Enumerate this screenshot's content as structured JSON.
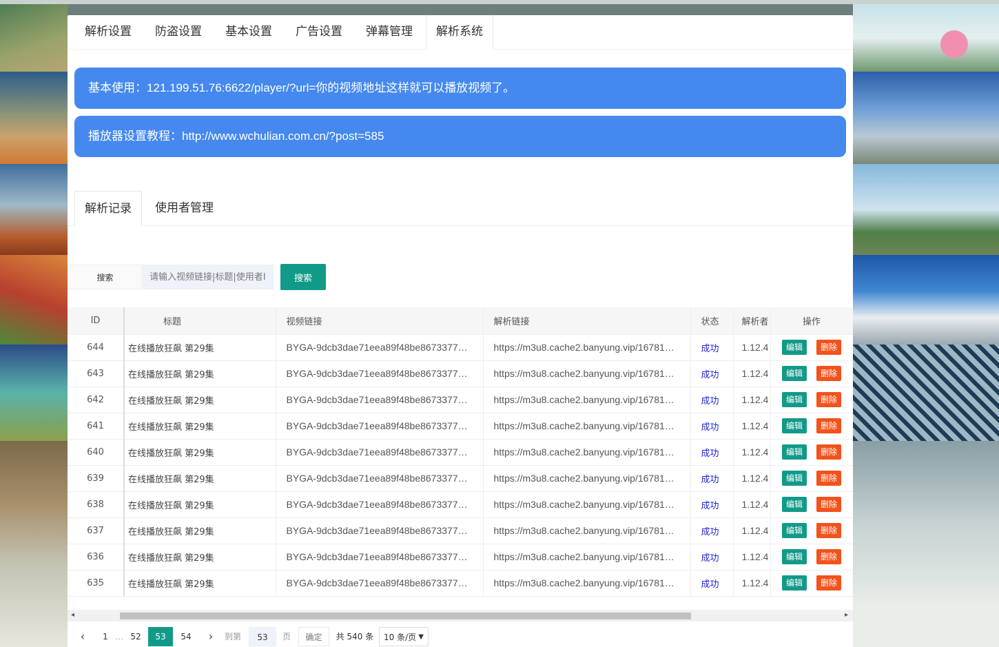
{
  "nav": {
    "tabs": [
      "解析设置",
      "防盗设置",
      "基本设置",
      "广告设置",
      "弹幕管理",
      "解析系统"
    ],
    "active": "解析系统"
  },
  "notices": [
    "基本使用：121.199.51.76:6622/player/?url=你的视频地址这样就可以播放视频了。",
    "播放器设置教程：http://www.wchulian.com.cn/?post=585"
  ],
  "subtabs": [
    "解析记录",
    "使用者管理"
  ],
  "search": {
    "label": "搜索",
    "placeholder": "请输入视频链接|标题|使用者IP",
    "button": "搜索"
  },
  "table": {
    "headers": [
      "ID",
      "标题",
      "视频链接",
      "解析链接",
      "状态",
      "解析者",
      "操作"
    ],
    "edit_label": "编辑",
    "delete_label": "删除",
    "rows": [
      {
        "id": "644",
        "title": "在线播放狂飙 第29集",
        "video": "BYGA-9dcb3dae71eea89f48be8673377…",
        "parse": "https://m3u8.cache2.banyung.vip/16781…",
        "status": "成功",
        "ip": "1.12.4"
      },
      {
        "id": "643",
        "title": "在线播放狂飙 第29集",
        "video": "BYGA-9dcb3dae71eea89f48be8673377…",
        "parse": "https://m3u8.cache2.banyung.vip/16781…",
        "status": "成功",
        "ip": "1.12.4"
      },
      {
        "id": "642",
        "title": "在线播放狂飙 第29集",
        "video": "BYGA-9dcb3dae71eea89f48be8673377…",
        "parse": "https://m3u8.cache2.banyung.vip/16781…",
        "status": "成功",
        "ip": "1.12.4"
      },
      {
        "id": "641",
        "title": "在线播放狂飙 第29集",
        "video": "BYGA-9dcb3dae71eea89f48be8673377…",
        "parse": "https://m3u8.cache2.banyung.vip/16781…",
        "status": "成功",
        "ip": "1.12.4"
      },
      {
        "id": "640",
        "title": "在线播放狂飙 第29集",
        "video": "BYGA-9dcb3dae71eea89f48be8673377…",
        "parse": "https://m3u8.cache2.banyung.vip/16781…",
        "status": "成功",
        "ip": "1.12.4"
      },
      {
        "id": "639",
        "title": "在线播放狂飙 第29集",
        "video": "BYGA-9dcb3dae71eea89f48be8673377…",
        "parse": "https://m3u8.cache2.banyung.vip/16781…",
        "status": "成功",
        "ip": "1.12.4"
      },
      {
        "id": "638",
        "title": "在线播放狂飙 第29集",
        "video": "BYGA-9dcb3dae71eea89f48be8673377…",
        "parse": "https://m3u8.cache2.banyung.vip/16781…",
        "status": "成功",
        "ip": "1.12.4"
      },
      {
        "id": "637",
        "title": "在线播放狂飙 第29集",
        "video": "BYGA-9dcb3dae71eea89f48be8673377…",
        "parse": "https://m3u8.cache2.banyung.vip/16781…",
        "status": "成功",
        "ip": "1.12.4"
      },
      {
        "id": "636",
        "title": "在线播放狂飙 第29集",
        "video": "BYGA-9dcb3dae71eea89f48be8673377…",
        "parse": "https://m3u8.cache2.banyung.vip/16781…",
        "status": "成功",
        "ip": "1.12.4"
      },
      {
        "id": "635",
        "title": "在线播放狂飙 第29集",
        "video": "BYGA-9dcb3dae71eea89f48be8673377…",
        "parse": "https://m3u8.cache2.banyung.vip/16781…",
        "status": "成功",
        "ip": "1.12.4"
      }
    ]
  },
  "pagination": {
    "pages": [
      "1",
      "…",
      "52",
      "53",
      "54"
    ],
    "current": "53",
    "goto_label": "到第",
    "goto_value": "53",
    "page_unit": "页",
    "confirm": "确定",
    "total": "共 540 条",
    "page_size": "10 条/页"
  },
  "colors": {
    "accent": "#129a89",
    "notice": "#4589ef",
    "danger": "#f2521c",
    "status_success": "#1e22d6"
  },
  "icons": {
    "prev": "chevron-left-icon",
    "next": "chevron-right-icon",
    "select": "chevron-down-icon"
  }
}
